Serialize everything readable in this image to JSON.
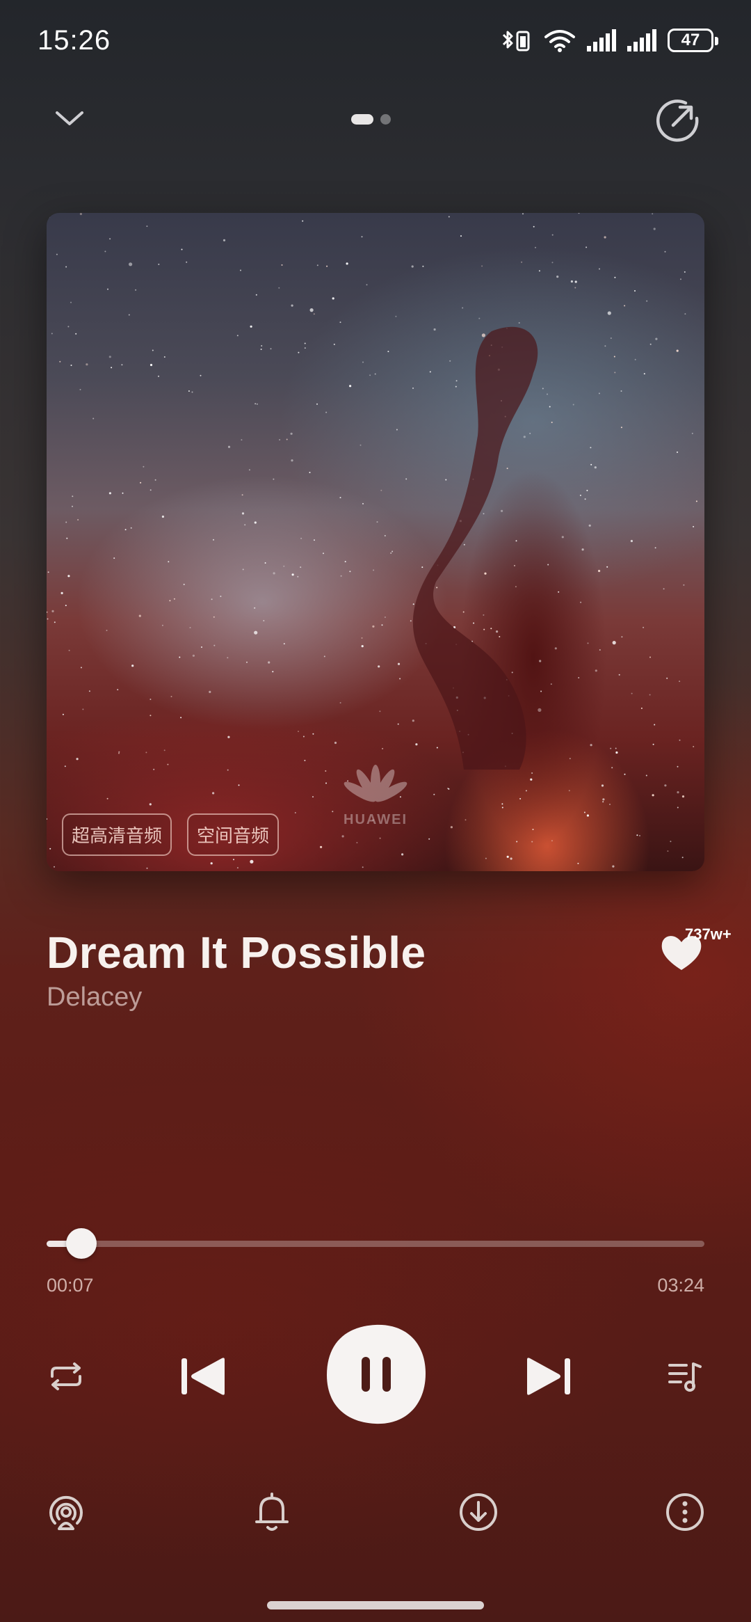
{
  "status_bar": {
    "time": "15:26",
    "battery_level": "47",
    "icons": [
      "bluetooth-icon",
      "wifi-icon",
      "signal-icon",
      "signal-icon",
      "battery-icon"
    ]
  },
  "nav": {
    "pager": {
      "page_count": 2,
      "active_index": 0
    },
    "icons": [
      "chevron-down-icon",
      "share-icon"
    ]
  },
  "cover": {
    "watermark": "HUAWEI",
    "badges": [
      "超高清音频",
      "空间音频"
    ]
  },
  "song": {
    "title": "Dream It Possible",
    "artist": "Delacey",
    "like_count": "737w+"
  },
  "progress": {
    "current": "00:07",
    "total": "03:24",
    "fraction": 0.034
  },
  "controls": {
    "icons": [
      "repeat-icon",
      "previous-icon",
      "pause-icon",
      "next-icon",
      "queue-icon"
    ],
    "bottom_icons": [
      "cast-icon",
      "alarm-icon",
      "download-icon",
      "more-icon"
    ]
  },
  "colors": {
    "accent": "#f5f2f1",
    "background_top": "#23262b",
    "background_bottom": "#5c1d17"
  }
}
